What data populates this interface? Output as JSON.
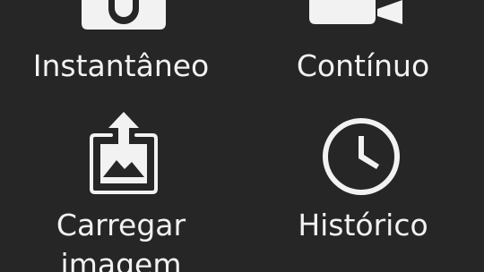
{
  "menu": {
    "snapshot": {
      "label": "Instantâneo",
      "icon": "camera-icon"
    },
    "continuous": {
      "label": "Contínuo",
      "icon": "video-camera-icon"
    },
    "upload": {
      "label_line1": "Carregar",
      "label_line2": "imagem",
      "icon": "upload-image-icon"
    },
    "history": {
      "label": "Histórico",
      "icon": "clock-icon"
    }
  },
  "colors": {
    "background": "#262626",
    "foreground": "#f2f2f2"
  }
}
